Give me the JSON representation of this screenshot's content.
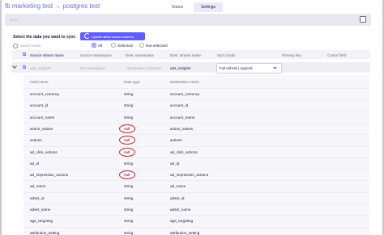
{
  "header": {
    "title": "fb marketing test → postgres test",
    "tabs": [
      {
        "label": "Status",
        "active": false
      },
      {
        "label": "Settings",
        "active": true
      }
    ]
  },
  "prefix": {
    "placeholder": "prefix"
  },
  "sync_section": {
    "title": "Select the data you want to sync",
    "refresh_button": "Update latest source schema"
  },
  "filter": {
    "search_placeholder": "Search name",
    "options": [
      "All",
      "Selected",
      "Not selected"
    ],
    "selected": "All"
  },
  "stream_columns": [
    "Source stream name",
    "Source namespace",
    "Dest. namespace",
    "Dest. stream name",
    "Sync mode",
    "Primary key",
    "Cursor field"
  ],
  "stream": {
    "source_name": "ads_insights",
    "source_namespace": "No namespace",
    "dest_namespace": "<destination schema>",
    "dest_name": "ads_insights",
    "sync_mode": "Full refresh | Append"
  },
  "field_columns": [
    "Field name",
    "Data type",
    "Destination name"
  ],
  "fields": [
    {
      "name": "account_currency",
      "type": "string",
      "dest": "account_currency"
    },
    {
      "name": "account_id",
      "type": "string",
      "dest": "account_id"
    },
    {
      "name": "account_name",
      "type": "string",
      "dest": "account_name"
    },
    {
      "name": "action_values",
      "type": "null",
      "dest": "action_values"
    },
    {
      "name": "actions",
      "type": "null",
      "dest": "actions"
    },
    {
      "name": "ad_click_actions",
      "type": "null",
      "dest": "ad_click_actions"
    },
    {
      "name": "ad_id",
      "type": "string",
      "dest": "ad_id"
    },
    {
      "name": "ad_impression_actions",
      "type": "null",
      "dest": "ad_impression_actions"
    },
    {
      "name": "ad_name",
      "type": "string",
      "dest": "ad_name"
    },
    {
      "name": "adset_id",
      "type": "string",
      "dest": "adset_id"
    },
    {
      "name": "adset_name",
      "type": "string",
      "dest": "adset_name"
    },
    {
      "name": "age_targeting",
      "type": "string",
      "dest": "age_targeting"
    },
    {
      "name": "attribution_setting",
      "type": "string",
      "dest": "attribution_setting"
    }
  ],
  "colors": {
    "accent": "#615eff",
    "highlight": "#e02020"
  }
}
